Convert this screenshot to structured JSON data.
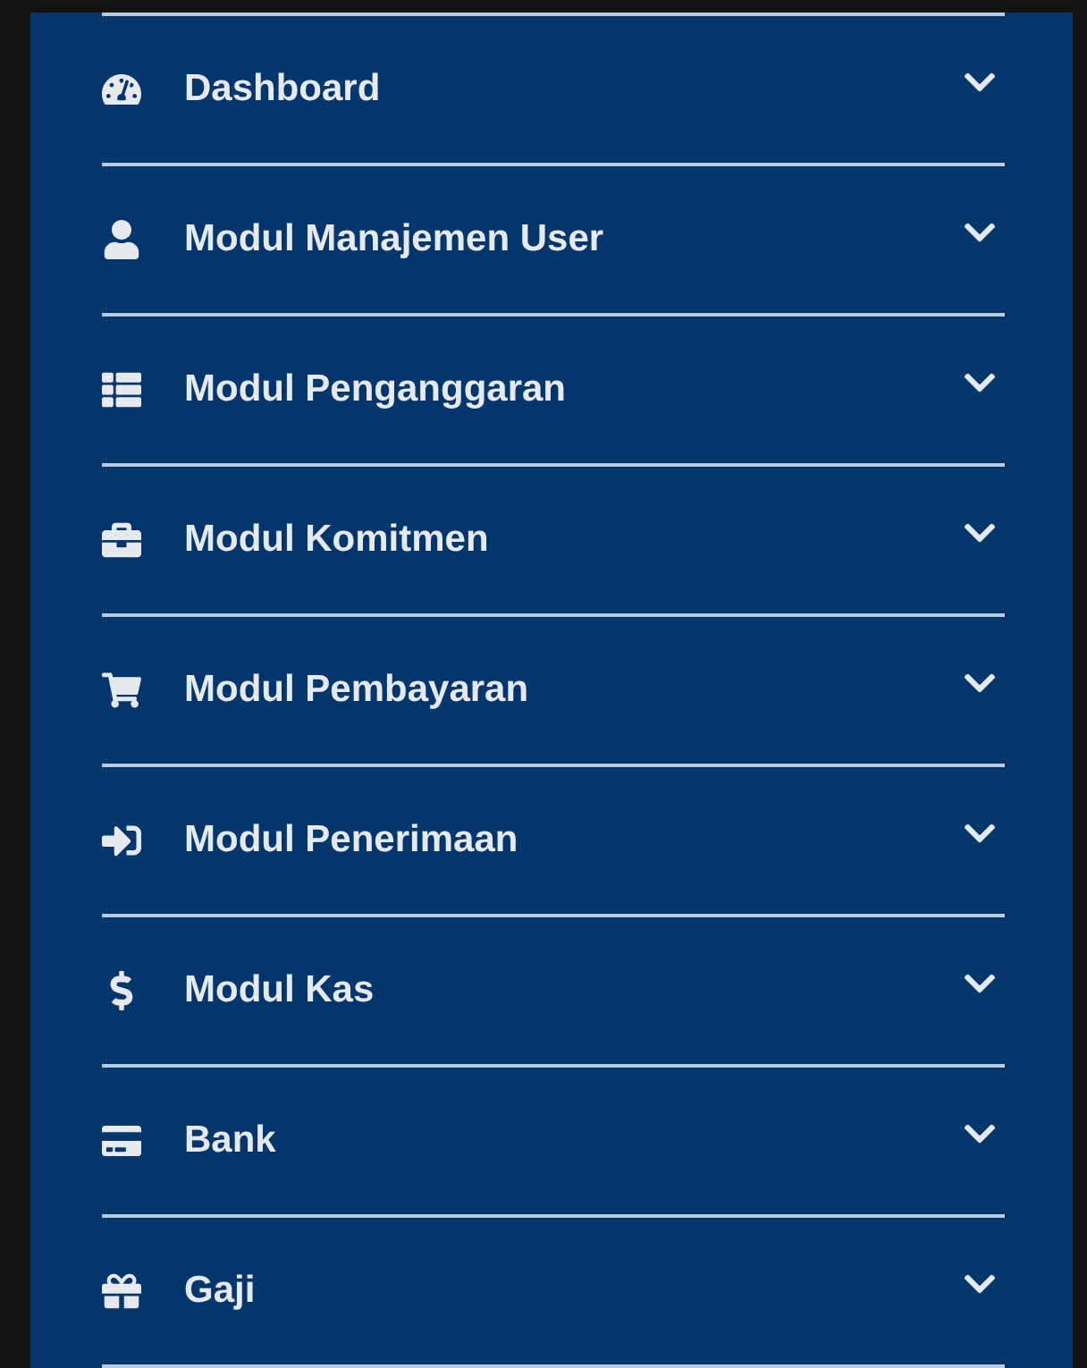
{
  "sidebar": {
    "items": [
      {
        "label": "Dashboard",
        "expanded": false
      },
      {
        "label": "Modul Manajemen User",
        "expanded": false
      },
      {
        "label": "Modul Penganggaran",
        "expanded": false
      },
      {
        "label": "Modul Komitmen",
        "expanded": false
      },
      {
        "label": "Modul Pembayaran",
        "expanded": false
      },
      {
        "label": "Modul Penerimaan",
        "expanded": false
      },
      {
        "label": "Modul Kas",
        "expanded": false
      },
      {
        "label": "Bank",
        "expanded": false
      },
      {
        "label": "Gaji",
        "expanded": false
      }
    ]
  }
}
